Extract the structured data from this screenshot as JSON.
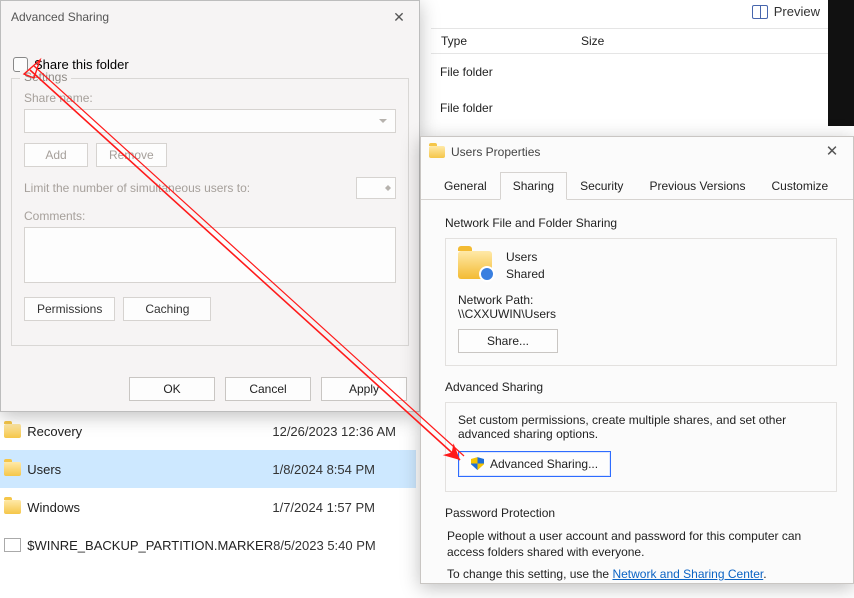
{
  "explorer": {
    "preview_label": "Preview",
    "columns": {
      "type": "Type",
      "size": "Size"
    },
    "bg_rows": [
      "File folder",
      "File folder"
    ],
    "rows": [
      {
        "name": "Recovery",
        "date": "12/26/2023 12:36 AM",
        "icon": "folder",
        "selected": false
      },
      {
        "name": "Users",
        "date": "1/8/2024 8:54 PM",
        "icon": "folder",
        "selected": true
      },
      {
        "name": "Windows",
        "date": "1/7/2024 1:57 PM",
        "icon": "folder",
        "selected": false
      },
      {
        "name": "$WINRE_BACKUP_PARTITION.MARKER",
        "date": "8/5/2023 5:40 PM",
        "icon": "file",
        "selected": false
      }
    ]
  },
  "adv": {
    "title": "Advanced Sharing",
    "share_checkbox": "Share this folder",
    "settings_legend": "Settings",
    "share_name_label": "Share name:",
    "add": "Add",
    "remove": "Remove",
    "limit_label": "Limit the number of simultaneous users to:",
    "comments_label": "Comments:",
    "permissions": "Permissions",
    "caching": "Caching",
    "ok": "OK",
    "cancel": "Cancel",
    "apply": "Apply"
  },
  "props": {
    "title": "Users Properties",
    "tabs": {
      "general": "General",
      "sharing": "Sharing",
      "security": "Security",
      "previous": "Previous Versions",
      "customize": "Customize"
    },
    "nf_title": "Network File and Folder Sharing",
    "folder_name": "Users",
    "shared_state": "Shared",
    "network_path_label": "Network Path:",
    "network_path": "\\\\CXXUWIN\\Users",
    "share_btn": "Share...",
    "adv_title": "Advanced Sharing",
    "adv_desc": "Set custom permissions, create multiple shares, and set other advanced sharing options.",
    "adv_btn": "Advanced Sharing...",
    "pw_title": "Password Protection",
    "pw_desc": "People without a user account and password for this computer can access folders shared with everyone.",
    "pw_change_prefix": "To change this setting, use the ",
    "pw_link": "Network and Sharing Center",
    "pw_change_suffix": "."
  }
}
